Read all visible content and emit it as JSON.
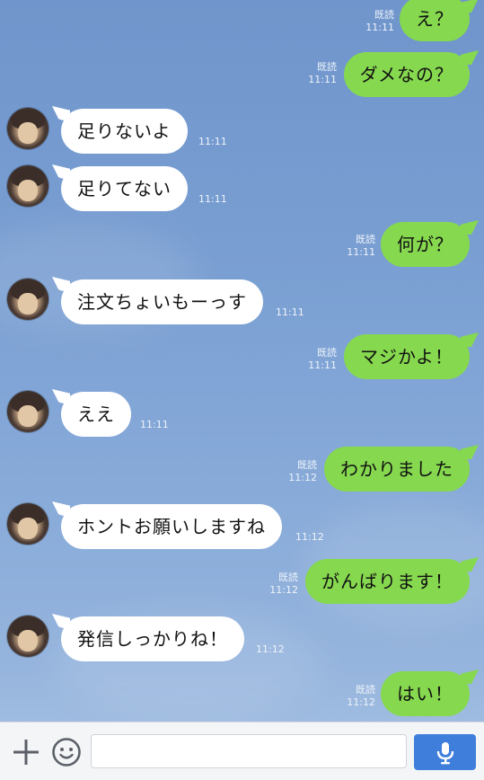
{
  "messages": [
    {
      "side": "out",
      "text": "え？",
      "read": "既読",
      "time": "11:11"
    },
    {
      "side": "out",
      "text": "ダメなの？",
      "read": "既読",
      "time": "11:11"
    },
    {
      "side": "in",
      "text": "足りないよ",
      "time": "11:11"
    },
    {
      "side": "in",
      "text": "足りてない",
      "time": "11:11"
    },
    {
      "side": "out",
      "text": "何が？",
      "read": "既読",
      "time": "11:11"
    },
    {
      "side": "in",
      "text": "注文ちょいもーっす",
      "time": "11:11"
    },
    {
      "side": "out",
      "text": "マジかよ！",
      "read": "既読",
      "time": "11:11"
    },
    {
      "side": "in",
      "text": "ええ",
      "time": "11:11"
    },
    {
      "side": "out",
      "text": "わかりました",
      "read": "既読",
      "time": "11:12"
    },
    {
      "side": "in",
      "text": "ホントお願いしますね",
      "time": "11:12"
    },
    {
      "side": "out",
      "text": "がんばります！",
      "read": "既読",
      "time": "11:12"
    },
    {
      "side": "in",
      "text": "発信しっかりね！",
      "time": "11:12"
    },
    {
      "side": "out",
      "text": "はい！",
      "read": "既読",
      "time": "11:12"
    }
  ],
  "input": {
    "placeholder": ""
  },
  "icons": {
    "add": "plus-icon",
    "sticker": "smile-icon",
    "voice": "microphone-icon"
  },
  "colors": {
    "outgoing": "#86d84f",
    "incoming": "#ffffff",
    "send_button": "#3f7fdb"
  }
}
